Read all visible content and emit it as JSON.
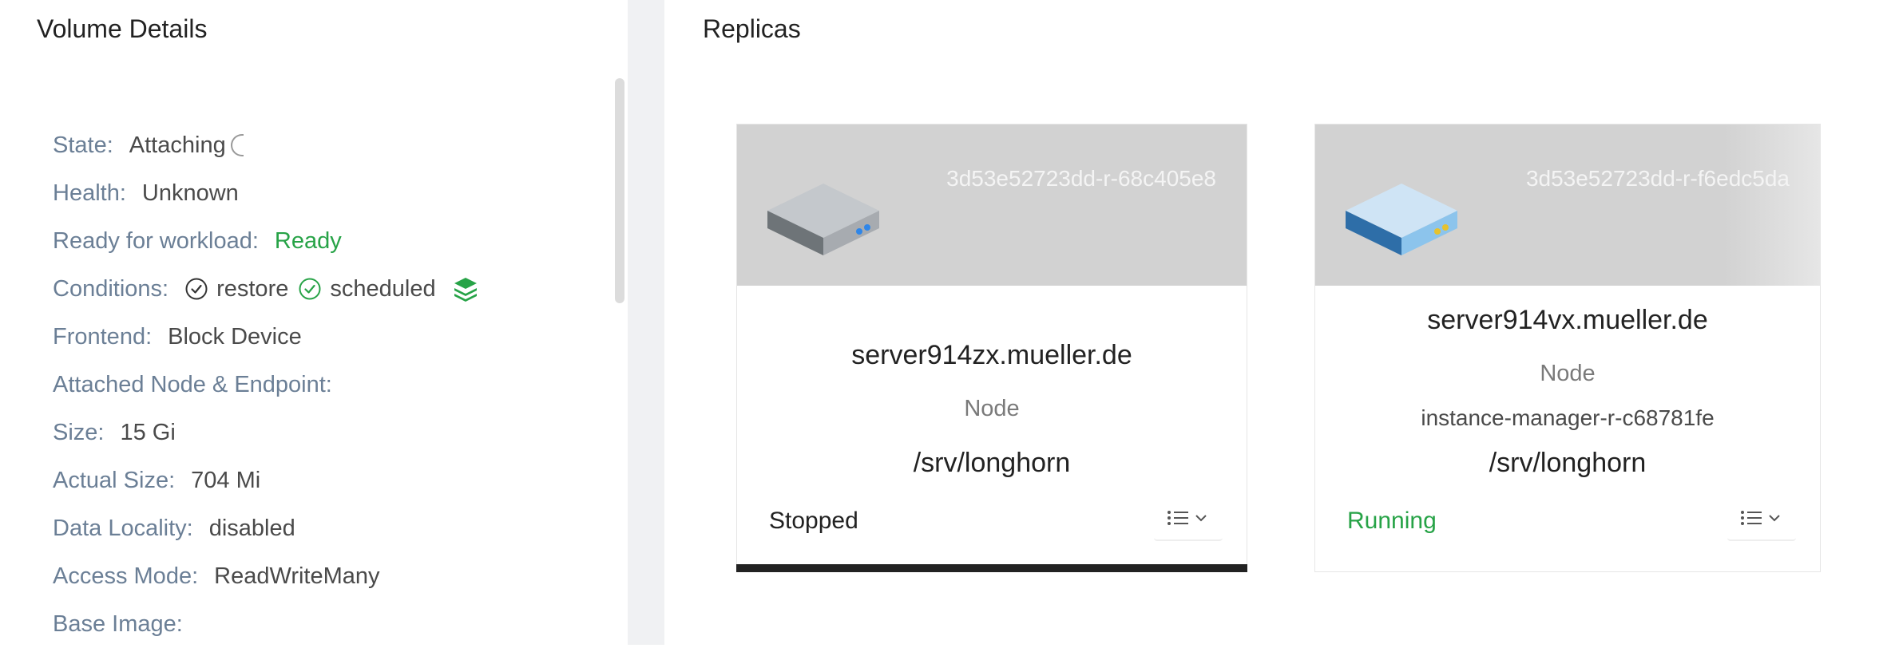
{
  "left": {
    "title": "Volume Details",
    "rows": {
      "state": {
        "label": "State:",
        "value": "Attaching"
      },
      "health": {
        "label": "Health:",
        "value": "Unknown"
      },
      "ready": {
        "label": "Ready for workload:",
        "value": "Ready"
      },
      "conditions": {
        "label": "Conditions:",
        "items": [
          "restore",
          "scheduled"
        ]
      },
      "frontend": {
        "label": "Frontend:",
        "value": "Block Device"
      },
      "attached": {
        "label": "Attached Node & Endpoint:"
      },
      "size": {
        "label": "Size:",
        "value": "15 Gi"
      },
      "actual_size": {
        "label": "Actual Size:",
        "value": "704 Mi"
      },
      "data_locality": {
        "label": "Data Locality:",
        "value": "disabled"
      },
      "access_mode": {
        "label": "Access Mode:",
        "value": "ReadWriteMany"
      },
      "base_image": {
        "label": "Base Image:"
      }
    }
  },
  "right": {
    "title": "Replicas",
    "replicas": [
      {
        "id": "3d53e52723dd-r-68c405e8",
        "host": "server914zx.mueller.de",
        "node_label": "Node",
        "path": "/srv/longhorn",
        "status": "Stopped"
      },
      {
        "id": "3d53e52723dd-r-f6edc5da",
        "host": "server914vx.mueller.de",
        "node_label": "Node",
        "instance_manager": "instance-manager-r-c68781fe",
        "path": "/srv/longhorn",
        "status": "Running"
      }
    ]
  },
  "colors": {
    "label": "#6b7f96",
    "green": "#27a347",
    "card_header": "#d2d2d2",
    "divider": "#f0f1f3"
  },
  "icons": [
    "check-circle-icon",
    "layers-icon",
    "server-icon",
    "list-icon",
    "chevron-down-icon",
    "spinner-icon"
  ]
}
